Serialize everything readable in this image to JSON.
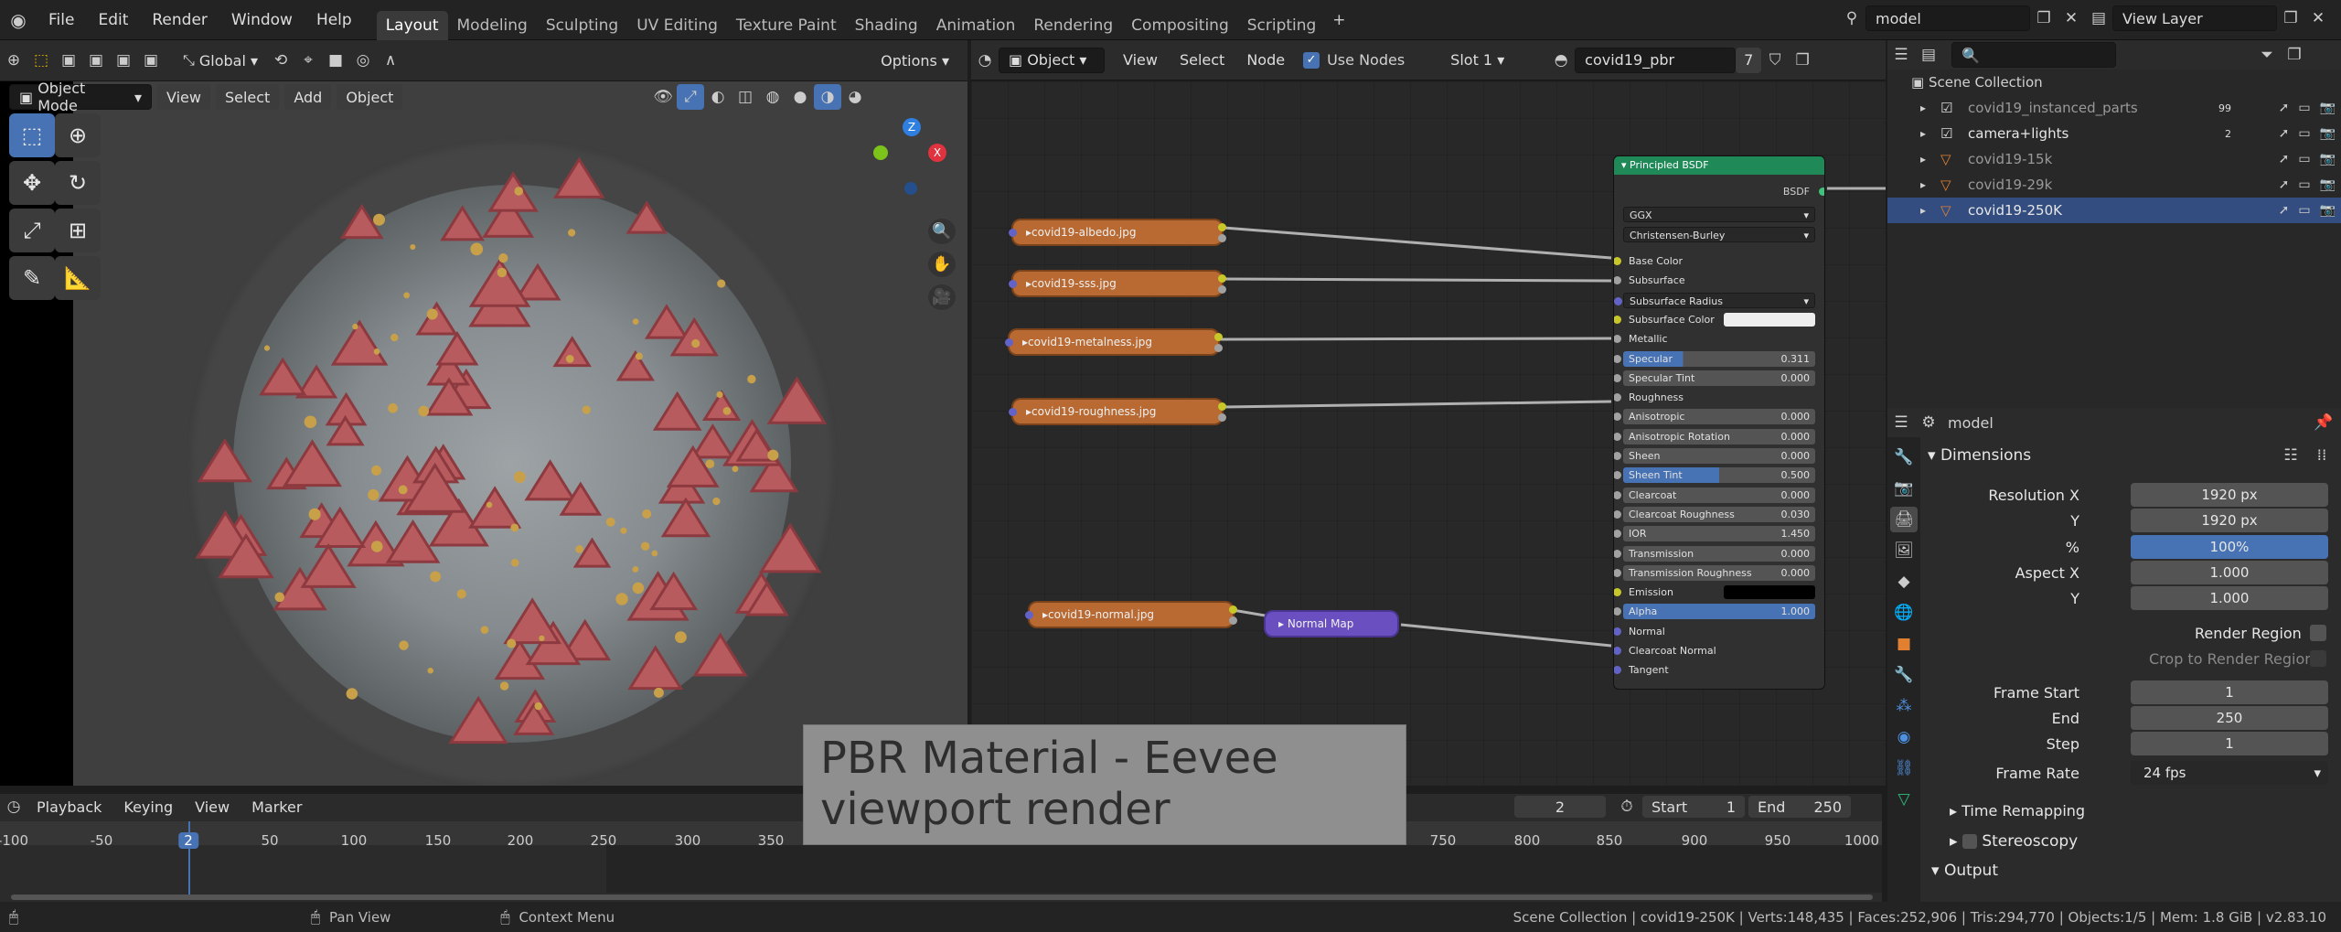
{
  "app": {
    "logo_icon": "blender-logo-icon"
  },
  "menu": [
    "File",
    "Edit",
    "Render",
    "Window",
    "Help"
  ],
  "workspaces": [
    "Layout",
    "Modeling",
    "Sculpting",
    "UV Editing",
    "Texture Paint",
    "Shading",
    "Animation",
    "Rendering",
    "Compositing",
    "Scripting"
  ],
  "active_workspace": "Layout",
  "scene_field": "model",
  "view_layer": "View Layer",
  "viewport": {
    "transform_orientation": "Global",
    "options": "Options",
    "mode": "Object Mode",
    "menus": [
      "View",
      "Select",
      "Add",
      "Object"
    ]
  },
  "node_editor": {
    "object_type": "Object",
    "menus": [
      "View",
      "Select",
      "Node"
    ],
    "use_nodes_label": "Use Nodes",
    "use_nodes_checked": true,
    "slot": "Slot 1",
    "material": "covid19_pbr",
    "users": "7",
    "texture_nodes": [
      "covid19-albedo.jpg",
      "covid19-sss.jpg",
      "covid19-metalness.jpg",
      "covid19-roughness.jpg",
      "covid19-normal.jpg"
    ],
    "normal_map_node": "Normal Map",
    "bsdf": {
      "title": "Principled BSDF",
      "output": "BSDF",
      "distribution": "GGX",
      "subsurface_method": "Christensen-Burley",
      "rows": [
        {
          "label": "Base Color",
          "type": "plain",
          "sock": "#c7c729"
        },
        {
          "label": "Subsurface",
          "type": "plain",
          "sock": "#a1a1a1"
        },
        {
          "label": "Subsurface Radius",
          "type": "dd",
          "sock": "#6363c7"
        },
        {
          "label": "Subsurface Color",
          "type": "color",
          "sock": "#c7c729"
        },
        {
          "label": "Metallic",
          "type": "plain",
          "sock": "#a1a1a1"
        },
        {
          "label": "Specular",
          "type": "fill",
          "value": "0.311",
          "fill": 0.311,
          "sock": "#a1a1a1"
        },
        {
          "label": "Specular Tint",
          "type": "field",
          "value": "0.000",
          "sock": "#a1a1a1"
        },
        {
          "label": "Roughness",
          "type": "plain",
          "sock": "#a1a1a1"
        },
        {
          "label": "Anisotropic",
          "type": "field",
          "value": "0.000",
          "sock": "#a1a1a1"
        },
        {
          "label": "Anisotropic Rotation",
          "type": "field",
          "value": "0.000",
          "sock": "#a1a1a1"
        },
        {
          "label": "Sheen",
          "type": "field",
          "value": "0.000",
          "sock": "#a1a1a1"
        },
        {
          "label": "Sheen Tint",
          "type": "fill",
          "value": "0.500",
          "fill": 0.5,
          "sock": "#a1a1a1"
        },
        {
          "label": "Clearcoat",
          "type": "field",
          "value": "0.000",
          "sock": "#a1a1a1"
        },
        {
          "label": "Clearcoat Roughness",
          "type": "field",
          "value": "0.030",
          "sock": "#a1a1a1"
        },
        {
          "label": "IOR",
          "type": "field",
          "value": "1.450",
          "sock": "#a1a1a1"
        },
        {
          "label": "Transmission",
          "type": "field",
          "value": "0.000",
          "sock": "#a1a1a1"
        },
        {
          "label": "Transmission Roughness",
          "type": "field",
          "value": "0.000",
          "sock": "#a1a1a1"
        },
        {
          "label": "Emission",
          "type": "black",
          "sock": "#c7c729"
        },
        {
          "label": "Alpha",
          "type": "fill",
          "value": "1.000",
          "fill": 1.0,
          "sock": "#a1a1a1"
        },
        {
          "label": "Normal",
          "type": "plain",
          "sock": "#6363c7"
        },
        {
          "label": "Clearcoat Normal",
          "type": "plain",
          "sock": "#6363c7"
        },
        {
          "label": "Tangent",
          "type": "plain",
          "sock": "#6363c7"
        }
      ]
    }
  },
  "outliner": {
    "root": "Scene Collection",
    "items": [
      {
        "name": "covid19_instanced_parts",
        "dim": true,
        "badge": "99"
      },
      {
        "name": "camera+lights",
        "dim": false,
        "badge": "2"
      },
      {
        "name": "covid19-15k",
        "dim": true,
        "badge": ""
      },
      {
        "name": "covid19-29k",
        "dim": true,
        "badge": ""
      },
      {
        "name": "covid19-250K",
        "dim": false,
        "badge": "",
        "selected": true
      }
    ]
  },
  "properties": {
    "context": "model",
    "panel": "Dimensions",
    "fields": [
      {
        "label": "Resolution X",
        "value": "1920 px"
      },
      {
        "label": "Y",
        "value": "1920 px"
      },
      {
        "label": "%",
        "value": "100%",
        "selected": true
      },
      {
        "label": "Aspect X",
        "value": "1.000"
      },
      {
        "label": "Y",
        "value": "1.000"
      }
    ],
    "render_region": "Render Region",
    "crop_region": "Crop to Render Region",
    "frames": [
      {
        "label": "Frame Start",
        "value": "1"
      },
      {
        "label": "End",
        "value": "250"
      },
      {
        "label": "Step",
        "value": "1"
      }
    ],
    "frame_rate_label": "Frame Rate",
    "frame_rate": "24 fps",
    "time_remapping": "Time Remapping",
    "stereoscopy": "Stereoscopy",
    "output": "Output"
  },
  "timeline": {
    "menus": [
      "Playback",
      "Keying",
      "View",
      "Marker"
    ],
    "current_frame": "2",
    "start_label": "Start",
    "start": "1",
    "end_label": "End",
    "end": "250",
    "ticks": [
      "-100",
      "-50",
      "2",
      "50",
      "100",
      "150",
      "200",
      "250",
      "300",
      "350",
      "750",
      "800",
      "850",
      "900",
      "950",
      "1000"
    ]
  },
  "caption": "PBR Material - Eevee viewport render",
  "status": {
    "pan": "Pan View",
    "context": "Context Menu",
    "stats": "Scene Collection | covid19-250K | Verts:148,435 | Faces:252,906 | Tris:294,770 | Objects:1/5 | Mem: 1.8 GiB | v2.83.10"
  },
  "colors": {
    "accent": "#4772b3",
    "node_header": "#1f8a58",
    "texture_node": "#b86a32",
    "normal_map_node": "#6a4fc0",
    "selected_row": "#334d80"
  }
}
